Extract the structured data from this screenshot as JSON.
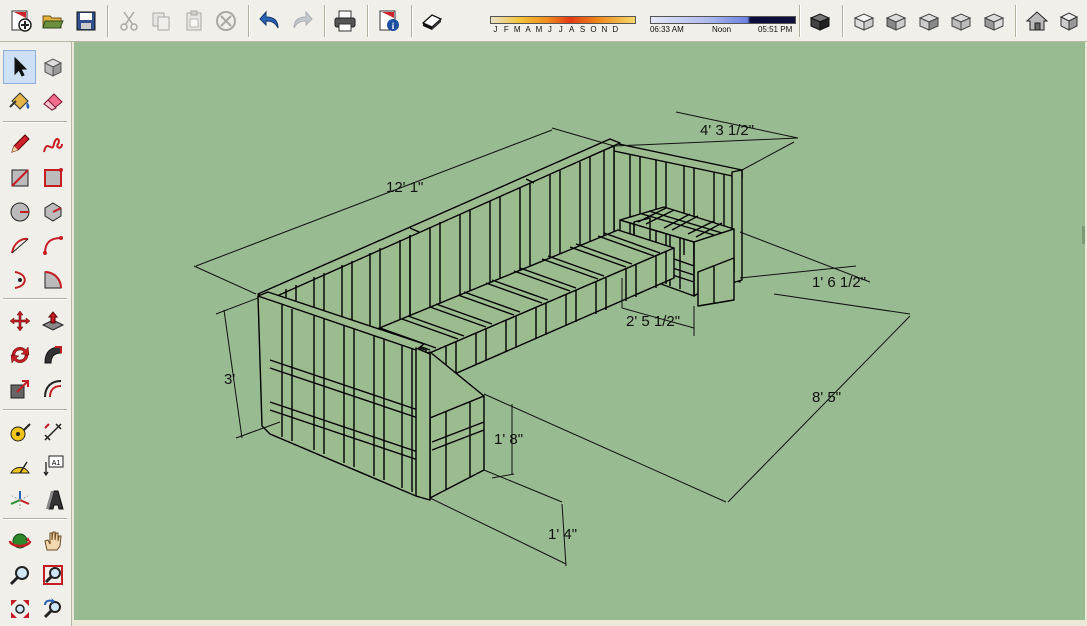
{
  "toolbar": {
    "groups": [
      [
        "new-icon",
        "open-icon",
        "save-icon"
      ],
      [
        "cut-icon",
        "copy-icon",
        "paste-icon",
        "erase-icon"
      ],
      [
        "undo-icon",
        "redo-icon"
      ],
      [
        "print-icon"
      ],
      [
        "model-info-icon"
      ]
    ],
    "shadow": {
      "months": [
        "J",
        "F",
        "M",
        "A",
        "M",
        "J",
        "J",
        "A",
        "S",
        "O",
        "N",
        "D"
      ],
      "time_start": "06:33 AM",
      "time_mid": "Noon",
      "time_end": "05:51 PM"
    },
    "views": [
      "iso-view-icon",
      "top-view-icon",
      "front-view-icon",
      "right-view-icon",
      "back-view-icon",
      "left-view-icon"
    ],
    "right": [
      "warehouse-icon",
      "components-icon"
    ]
  },
  "palette": {
    "tools": [
      "select-icon",
      "component-icon",
      "paint-bucket-icon",
      "eraser-icon",
      "pencil-icon",
      "freehand-icon",
      "rectangle-icon",
      "rotated-rectangle-icon",
      "circle-icon",
      "polygon-icon",
      "arc-icon",
      "two-point-arc-icon",
      "three-point-arc-icon",
      "pie-icon",
      "move-icon",
      "push-pull-icon",
      "rotate-icon",
      "follow-me-icon",
      "scale-icon",
      "offset-icon",
      "tape-measure-icon",
      "dimension-icon",
      "protractor-icon",
      "text-icon",
      "axes-icon",
      "3d-text-icon",
      "orbit-icon",
      "pan-icon",
      "zoom-icon",
      "zoom-window-icon",
      "zoom-extents-icon",
      "previous-view-icon"
    ],
    "text_tool_label": "A1"
  },
  "model": {
    "dimensions": {
      "back_length": "12' 1\"",
      "right_depth": "4' 3 1/2\"",
      "height": "3'",
      "side_seat_depth": "1' 6 1/2\"",
      "inner_width": "2' 5 1/2\"",
      "right_length": "8' 5\"",
      "seat_height": "1' 8\"",
      "base_height": "1' 4\""
    }
  },
  "colors": {
    "viewport_bg": "#99bb91",
    "wood_face": "#9bbc8e",
    "edge": "#000000",
    "chrome": "#f0efe9"
  }
}
